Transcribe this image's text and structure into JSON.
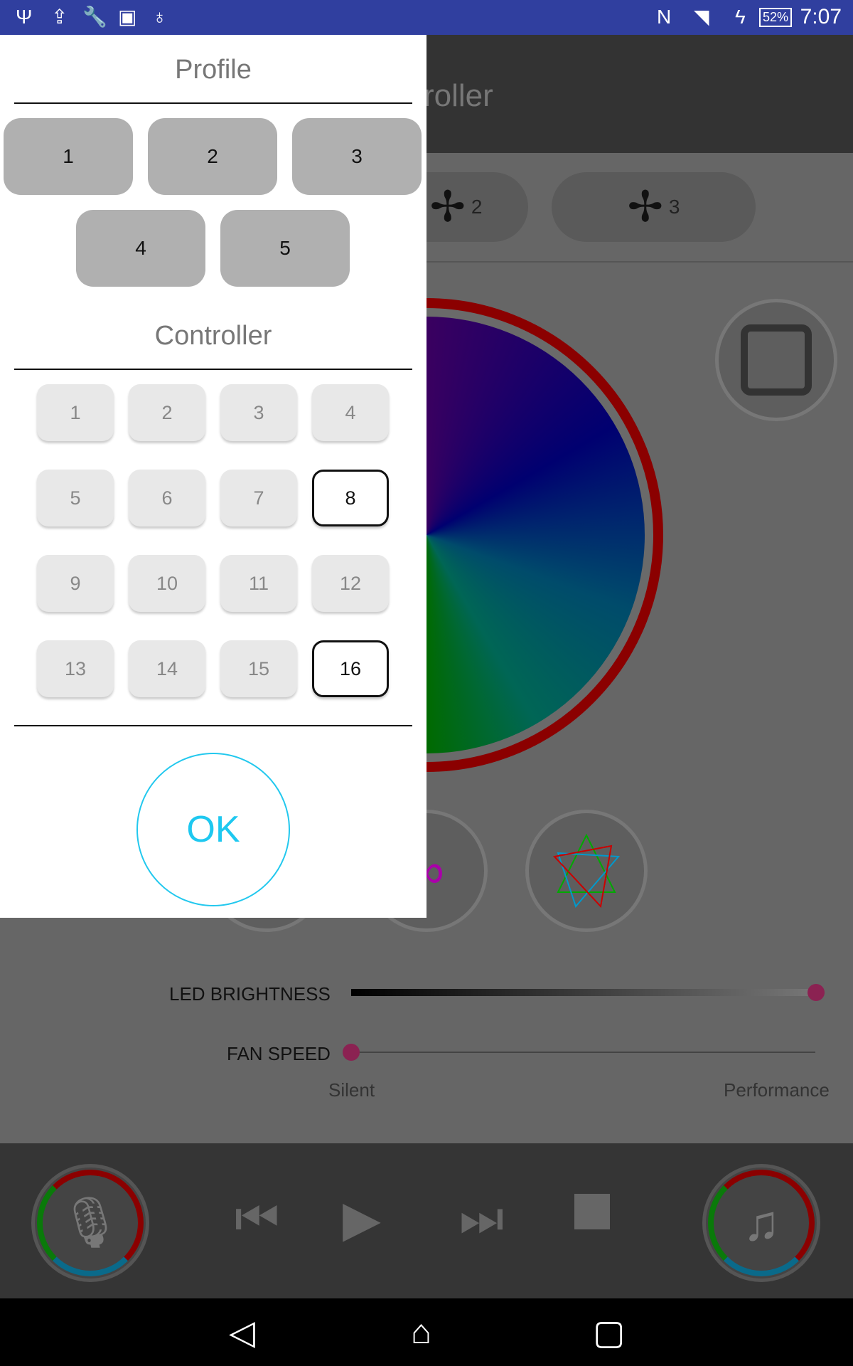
{
  "status_bar": {
    "icons": [
      "usb-icon",
      "upload-icon",
      "wrench-icon",
      "image-icon",
      "android-debug-icon",
      "nfc-icon",
      "wifi-icon",
      "charging-icon"
    ],
    "battery": "52%",
    "time": "7:07"
  },
  "background": {
    "header_title_visible": "roller",
    "fan_tabs": [
      {
        "label": "2"
      },
      {
        "label": "3"
      }
    ],
    "led_brightness_label": "LED BRIGHTNESS",
    "led_brightness_value": 1.0,
    "fan_speed_label": "FAN SPEED",
    "fan_speed_value": 0.0,
    "fan_speed_min": "Silent",
    "fan_speed_max": "Performance"
  },
  "dialog": {
    "profile_title": "Profile",
    "profiles": [
      "1",
      "2",
      "3",
      "4",
      "5"
    ],
    "controller_title": "Controller",
    "controllers": [
      "1",
      "2",
      "3",
      "4",
      "5",
      "6",
      "7",
      "8",
      "9",
      "10",
      "11",
      "12",
      "13",
      "14",
      "15",
      "16"
    ],
    "selected_controllers": [
      "8",
      "16"
    ],
    "ok_label": "OK"
  },
  "colors": {
    "accent": "#1ec8f0",
    "status_bar": "#303f9f",
    "slider_thumb": "#8b2252"
  }
}
